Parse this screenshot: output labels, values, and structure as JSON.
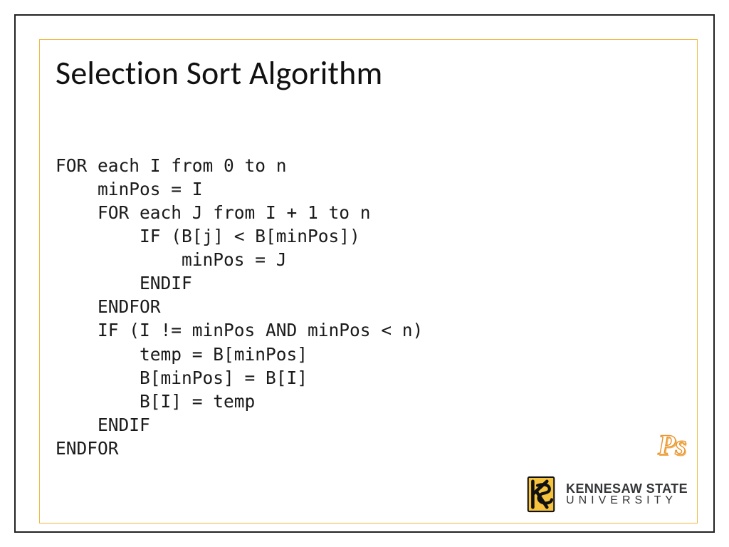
{
  "title": "Selection Sort Algorithm",
  "code": "FOR each I from 0 to n\n    minPos = I\n    FOR each J from I + 1 to n\n        IF (B[j] < B[minPos])\n            minPos = J\n        ENDIF\n    ENDFOR\n    IF (I != minPos AND minPos < n)\n        temp = B[minPos]\n        B[minPos] = B[I]\n        B[I] = temp\n    ENDIF\nENDFOR",
  "ps_label": "Ps",
  "university": {
    "name_top": "KENNESAW STATE",
    "name_bottom": "UNIVERSITY"
  }
}
